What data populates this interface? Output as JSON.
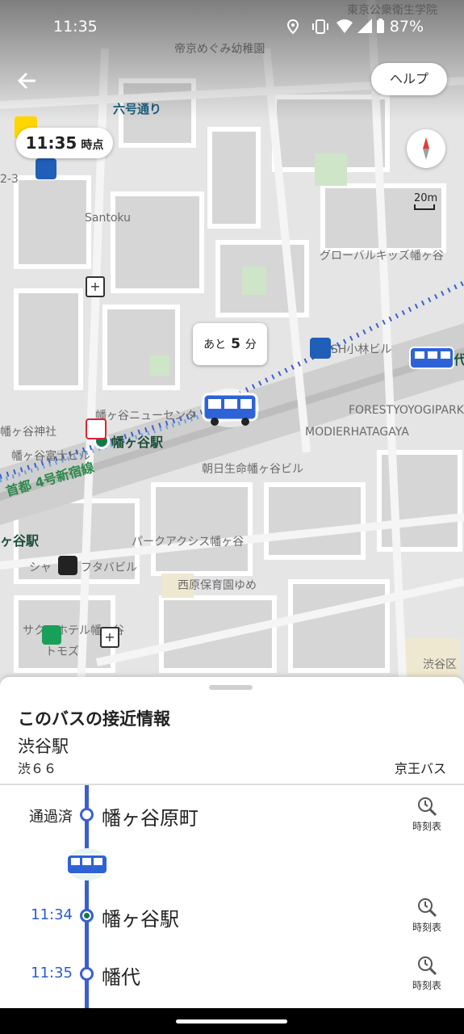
{
  "status_bar": {
    "time": "11:35",
    "battery": "87%"
  },
  "map": {
    "labels": {
      "kindergarten": "帝京めぐみ幼稚園",
      "top_edge": "東京公衆衛生学院",
      "santoku": "Santoku",
      "global_kids": "グローバルキッズ幡ヶ谷",
      "kobayashi": "SH小林ビル",
      "newcenter": "幡ヶ谷ニューセンタ",
      "forest": "FORESTYOYOGIPARK",
      "modier": "MODIERHATAGAYA",
      "asahi": "朝日生命幡ヶ谷ビル",
      "shrine": "幡ヶ谷神社",
      "fuji": "幡ヶ谷富士ビル",
      "parkaxis": "パークアクシス幡ヶ谷",
      "futaba": "フタバビル",
      "sha": "シャ",
      "nishihara": "西原保育園ゆめ",
      "sakura": "サクラホテル幡ヶ谷",
      "tomos": "トモズ",
      "shibuya_ku": "渋谷区",
      "address": "2-3",
      "hatagaya_edge": "ヶ谷駅",
      "daikan_edge": "代"
    },
    "street": "六号通り",
    "expressway": "首都 4号新宿線",
    "station": "幡ヶ谷駅"
  },
  "header": {
    "help": "ヘルプ",
    "time_chip": "11:35",
    "time_suffix": "時点",
    "scale": "20m"
  },
  "eta": {
    "prefix": "あと",
    "minutes": "5",
    "unit": "分"
  },
  "sheet": {
    "title": "このバスの接近情報",
    "destination": "渋谷駅",
    "route": "渋６６",
    "operator": "京王バス",
    "stops": [
      {
        "label": "通過済",
        "name": "幡ヶ谷原町",
        "timetable": "時刻表"
      },
      {
        "label": "11:34",
        "name": "幡ヶ谷駅",
        "timetable": "時刻表"
      },
      {
        "label": "11:35",
        "name": "幡代",
        "timetable": "時刻表"
      }
    ]
  },
  "colors": {
    "route_blue": "#3a5fd0",
    "time_blue": "#2a5bd7",
    "expressway_green": "#2c8a4a"
  }
}
